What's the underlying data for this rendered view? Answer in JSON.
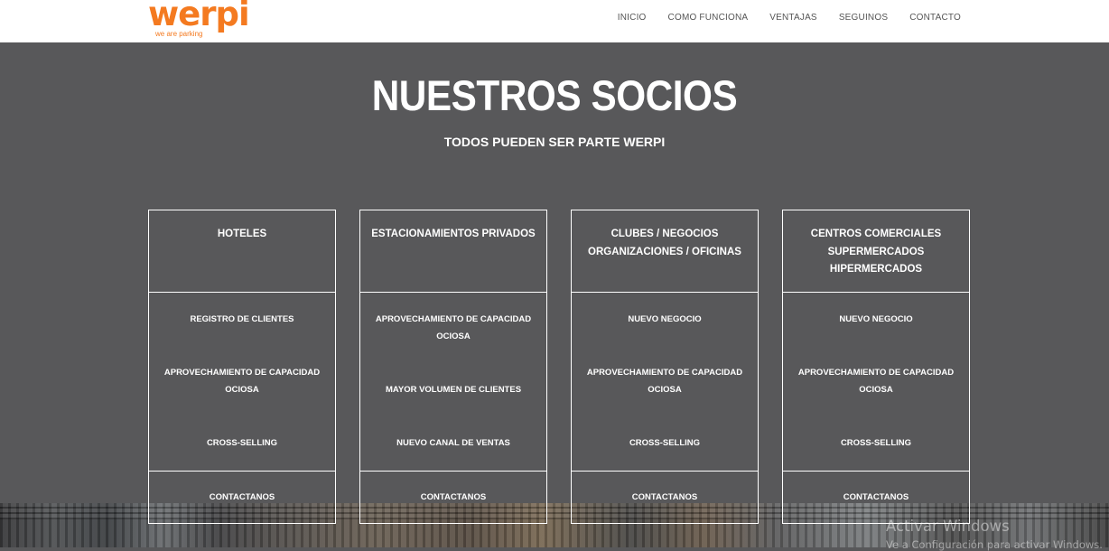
{
  "brand": {
    "name": "werpi",
    "tagline": "we are parking",
    "color": "#f47a20"
  },
  "nav": [
    "INICIO",
    "COMO FUNCIONA",
    "VENTAJAS",
    "SEGUINOS",
    "CONTACTO"
  ],
  "hero": {
    "title": "NUESTROS SOCIOS",
    "subtitle": "TODOS PUEDEN SER PARTE WERPI"
  },
  "cards": [
    {
      "title": [
        "HOTELES"
      ],
      "features": [
        [
          "REGISTRO DE CLIENTES"
        ],
        [
          "APROVECHAMIENTO DE CAPACIDAD",
          "OCIOSA"
        ],
        [
          "CROSS-SELLING"
        ]
      ],
      "cta": "CONTACTANOS"
    },
    {
      "title": [
        "ESTACIONAMIENTOS PRIVADOS"
      ],
      "features": [
        [
          "APROVECHAMIENTO DE CAPACIDAD",
          "OCIOSA"
        ],
        [
          "MAYOR VOLUMEN DE CLIENTES"
        ],
        [
          "NUEVO CANAL DE VENTAS"
        ]
      ],
      "cta": "CONTACTANOS"
    },
    {
      "title": [
        "CLUBES / NEGOCIOS",
        "ORGANIZACIONES / OFICINAS"
      ],
      "features": [
        [
          "NUEVO NEGOCIO"
        ],
        [
          "APROVECHAMIENTO DE CAPACIDAD",
          "OCIOSA"
        ],
        [
          "CROSS-SELLING"
        ]
      ],
      "cta": "CONTACTANOS"
    },
    {
      "title": [
        "CENTROS COMERCIALES",
        "SUPERMERCADOS",
        "HIPERMERCADOS"
      ],
      "features": [
        [
          "NUEVO NEGOCIO"
        ],
        [
          "APROVECHAMIENTO DE CAPACIDAD",
          "OCIOSA"
        ],
        [
          "CROSS-SELLING"
        ]
      ],
      "cta": "CONTACTANOS"
    }
  ],
  "windows_watermark": {
    "line1": "Activar Windows",
    "line2": "Ve a Configuración para activar Windows."
  }
}
